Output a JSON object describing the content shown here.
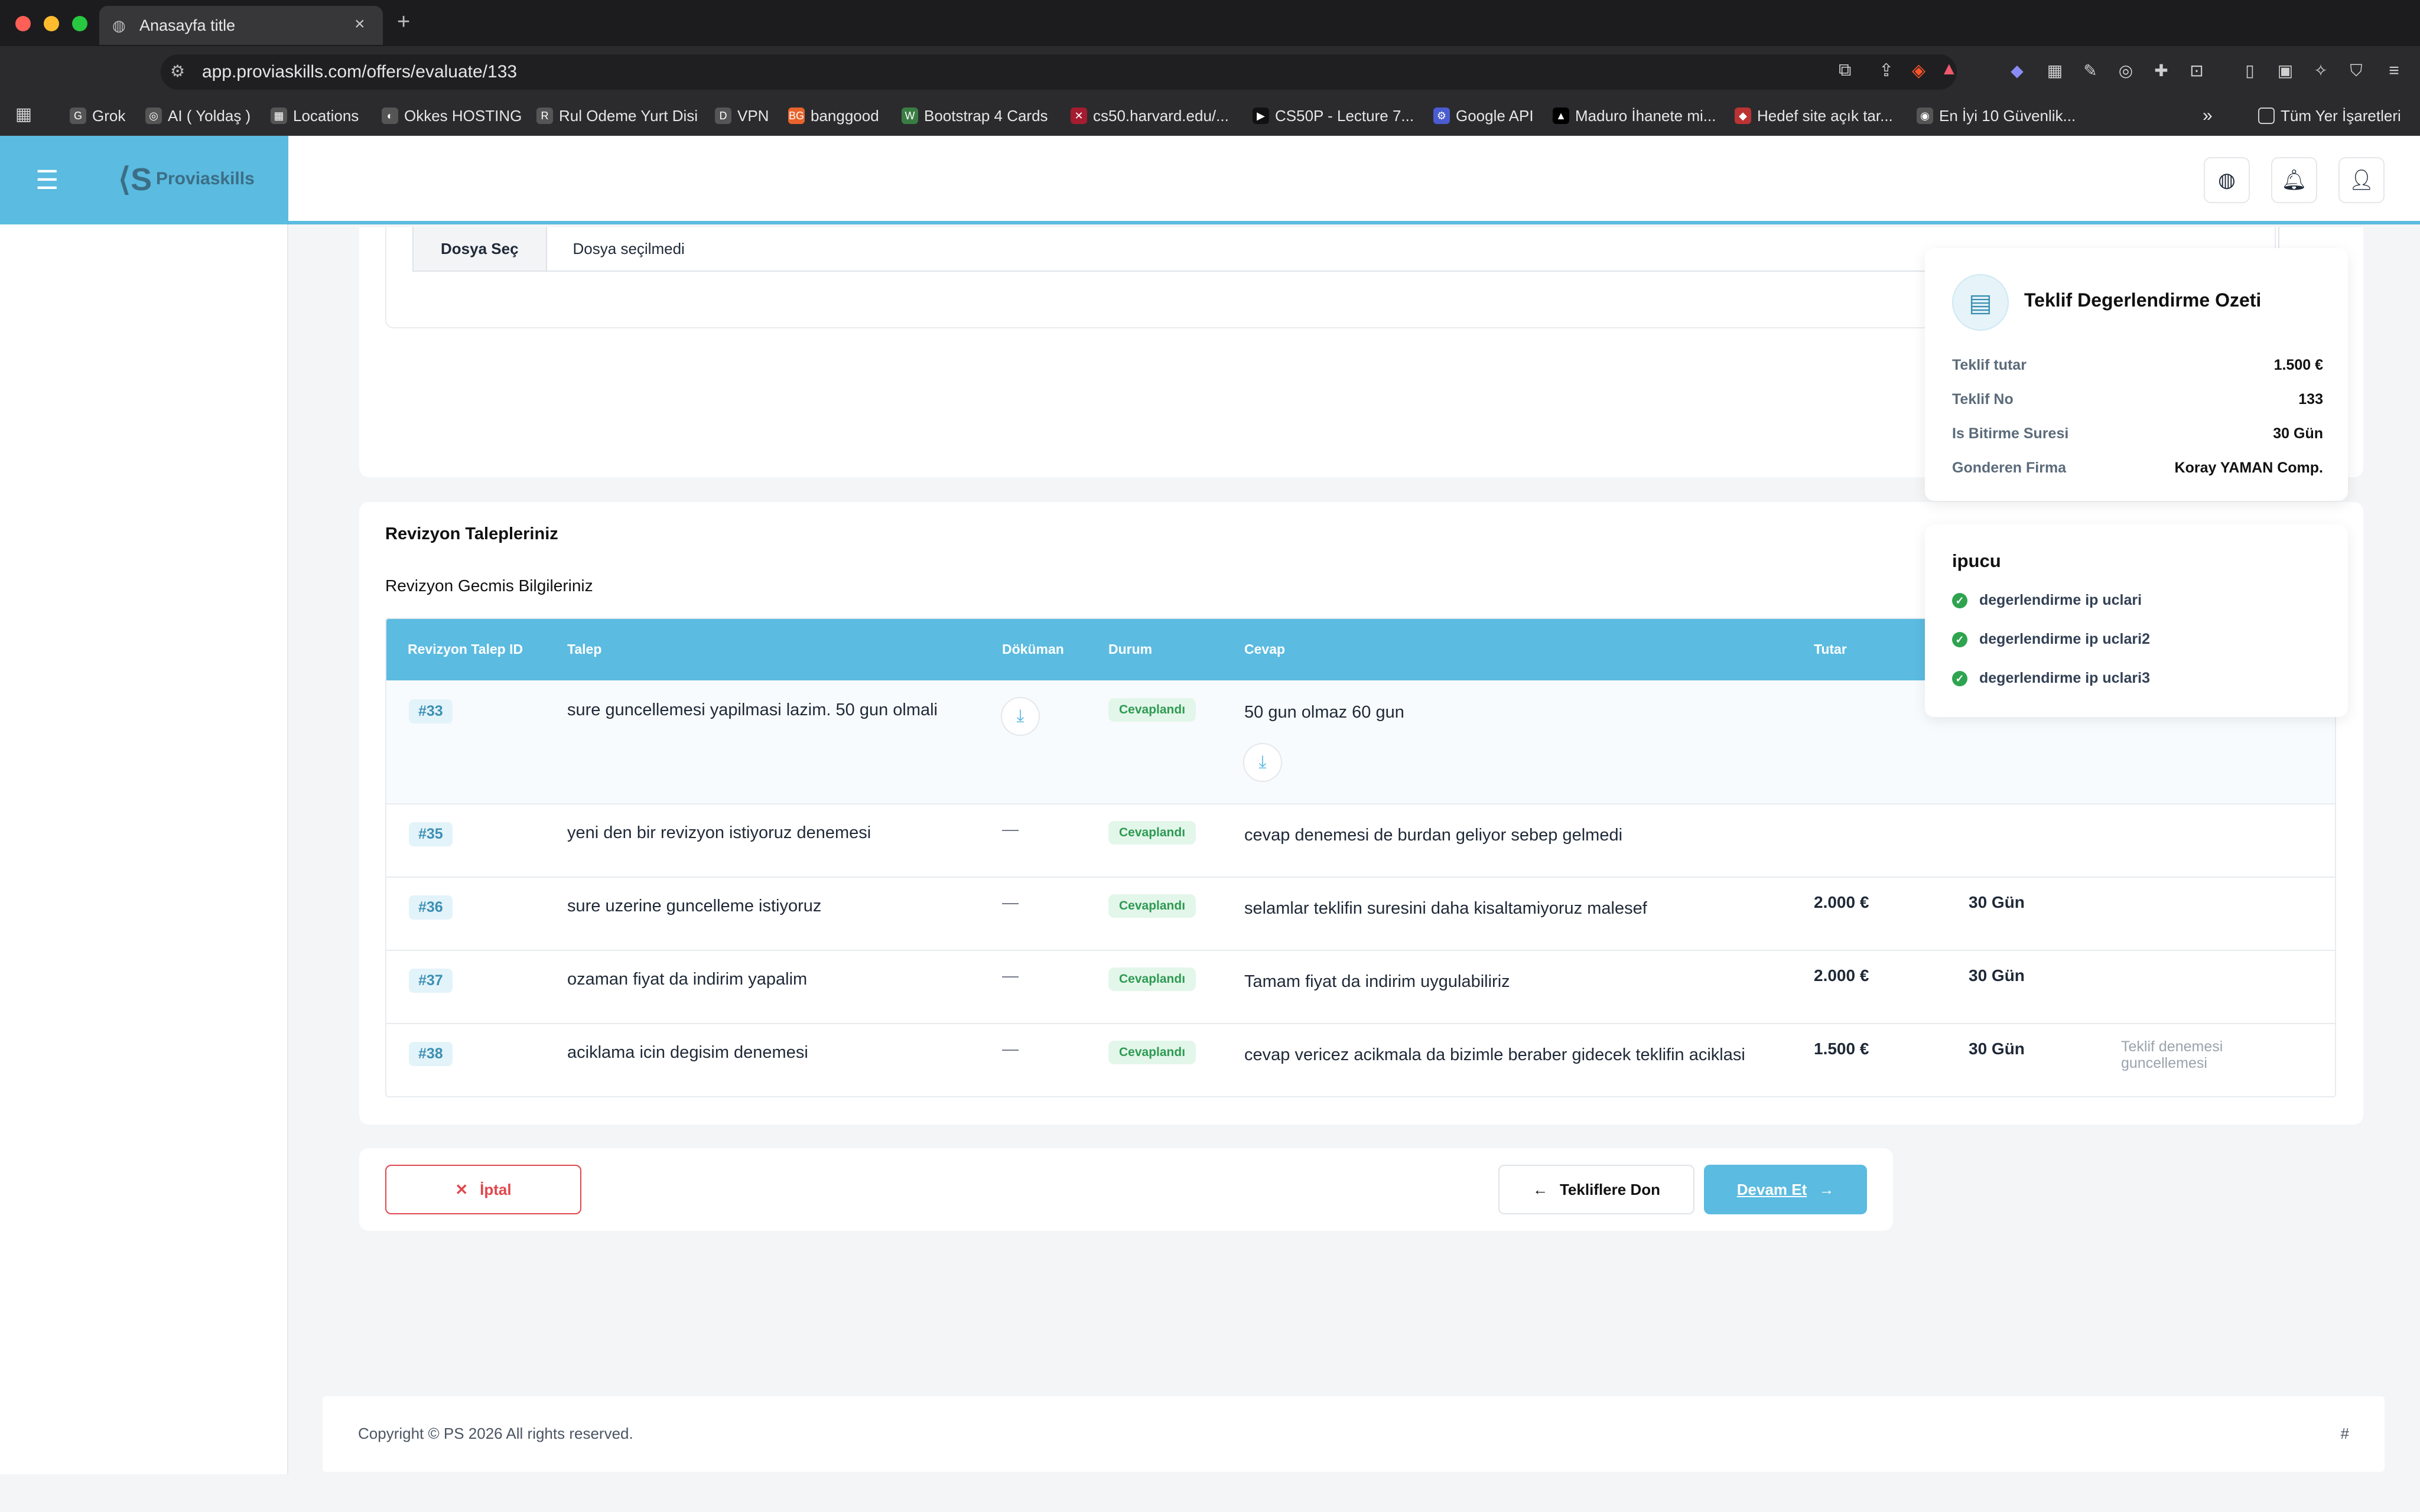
{
  "browser": {
    "tab_title": "Anasayfa title",
    "new_tab": "+",
    "url": "app.proviaskills.com/offers/evaluate/133",
    "bookmarks": [
      {
        "label": "Grok",
        "icon": "G"
      },
      {
        "label": "AI ( Yoldaş )",
        "icon": "◎"
      },
      {
        "label": "Locations",
        "icon": "▦"
      },
      {
        "label": "Okkes HOSTING",
        "icon": "◐"
      },
      {
        "label": "Rul Odeme Yurt Disi",
        "icon": "R"
      },
      {
        "label": "VPN",
        "icon": "D"
      },
      {
        "label": "banggood",
        "icon": "BG"
      },
      {
        "label": "Bootstrap 4 Cards",
        "icon": "W"
      },
      {
        "label": "cs50.harvard.edu/...",
        "icon": "✕"
      },
      {
        "label": "CS50P - Lecture 7...",
        "icon": "▶"
      },
      {
        "label": "Google API",
        "icon": "⚙"
      },
      {
        "label": "Maduro İhanete mi...",
        "icon": "▲"
      },
      {
        "label": "Hedef site açık tar...",
        "icon": "◆"
      },
      {
        "label": "En İyi 10 Güvenlik...",
        "icon": "◉"
      }
    ],
    "bookmarks_more": "»",
    "all_bookmarks": "Tüm Yer İşaretleri"
  },
  "app": {
    "brand": "Proviaskills",
    "accent": "#5bbbe0"
  },
  "file": {
    "choose_label": "Dosya Seç",
    "status": "Dosya seçilmedi"
  },
  "revisions": {
    "title": "Revizyon Talepleriniz",
    "subtitle": "Revizyon Gecmis Bilgileriniz",
    "columns": [
      "Revizyon Talep ID",
      "Talep",
      "Döküman",
      "Durum",
      "Cevap",
      "Tutar"
    ],
    "rows": [
      {
        "id": "#33",
        "request": "sure guncellemesi yapilmasi lazim. 50 gun olmali",
        "document": "",
        "status": "Cevaplandı",
        "answer": "50 gun olmaz 60 gun",
        "amount": "",
        "duration": "",
        "note": ""
      },
      {
        "id": "#35",
        "request": "yeni den bir revizyon istiyoruz denemesi",
        "document": "—",
        "status": "Cevaplandı",
        "answer": "cevap denemesi de burdan geliyor sebep gelmedi",
        "amount": "",
        "duration": "",
        "note": ""
      },
      {
        "id": "#36",
        "request": "sure uzerine guncelleme istiyoruz",
        "document": "—",
        "status": "Cevaplandı",
        "answer": "selamlar teklifin suresini daha kisaltamiyoruz malesef",
        "amount": "2.000 €",
        "duration": "30 Gün",
        "note": ""
      },
      {
        "id": "#37",
        "request": "ozaman fiyat da indirim yapalim",
        "document": "—",
        "status": "Cevaplandı",
        "answer": "Tamam fiyat da indirim uygulabiliriz",
        "amount": "2.000 €",
        "duration": "30 Gün",
        "note": ""
      },
      {
        "id": "#38",
        "request": "aciklama icin degisim denemesi",
        "document": "—",
        "status": "Cevaplandı",
        "answer": "cevap vericez acikmala da bizimle beraber gidecek teklifin aciklasi",
        "amount": "1.500 €",
        "duration": "30 Gün",
        "note": "Teklif denemesi guncellemesi"
      }
    ]
  },
  "actions": {
    "cancel": "İptal",
    "back": "Tekliflere Don",
    "continue": "Devam Et"
  },
  "summary": {
    "title": "Teklif Degerlendirme Ozeti",
    "items": [
      {
        "label": "Teklif tutar",
        "value": "1.500 €"
      },
      {
        "label": "Teklif No",
        "value": "133"
      },
      {
        "label": "Is Bitirme Suresi",
        "value": "30 Gün"
      },
      {
        "label": "Gonderen Firma",
        "value": "Koray YAMAN Comp."
      }
    ]
  },
  "tips": {
    "title": "ipucu",
    "items": [
      "degerlendirme ip uclari",
      "degerlendirme ip uclari2",
      "degerlendirme ip uclari3"
    ]
  },
  "footer": {
    "copyright": "Copyright © PS 2026 All rights reserved.",
    "hash": "#"
  }
}
